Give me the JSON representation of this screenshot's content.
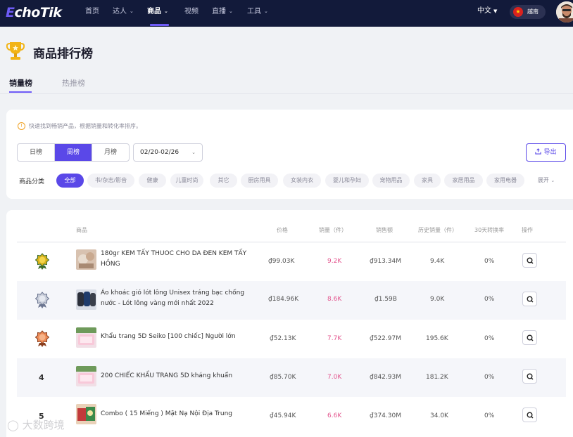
{
  "logo": {
    "first_letter": "E",
    "rest": "choTik"
  },
  "nav": {
    "items": [
      {
        "label": "首页",
        "chevron": false
      },
      {
        "label": "达人",
        "chevron": true
      },
      {
        "label": "商品",
        "chevron": true
      },
      {
        "label": "视频",
        "chevron": false
      },
      {
        "label": "直播",
        "chevron": true
      },
      {
        "label": "工具",
        "chevron": true
      }
    ],
    "active_index": 2,
    "language": "中文",
    "region": "越南"
  },
  "page": {
    "title": "商品排行榜",
    "tabs": [
      {
        "label": "销量榜"
      },
      {
        "label": "热推榜"
      }
    ]
  },
  "filters": {
    "hint": "快速找到畅销产品，根据销量和转化率排序。",
    "period_options": [
      "日榜",
      "周榜",
      "月榜"
    ],
    "period_selected": "周榜",
    "date_range": "02/20-02/26",
    "export_label": "导出",
    "category_label": "商品分类",
    "categories": [
      "全部",
      "书/杂志/影音",
      "健康",
      "儿童时尚",
      "其它",
      "厨房用具",
      "女装内衣",
      "婴儿和孕妇",
      "宠物用品",
      "家具",
      "家居用品",
      "家用电器"
    ],
    "category_selected": "全部",
    "expand_label": "展开"
  },
  "table": {
    "headers": {
      "product": "商品",
      "price": "价格",
      "sales": "销量（件）",
      "revenue": "销售额",
      "history_sales": "历史销量（件）",
      "conversion": "30天转换率",
      "action": "操作"
    },
    "rows": [
      {
        "rank": "1",
        "name": "180gr KEM TẤY THUOC CHO DA ĐEN KEM TẤY HỒNG",
        "price": "₫99.03K",
        "sales": "9.2K",
        "revenue": "₫913.34M",
        "history_sales": "9.4K",
        "conversion": "0%"
      },
      {
        "rank": "2",
        "name": "Áo khoác gió lót lông Unisex tráng bạc chống nước - Lót lông vàng mới nhất 2022",
        "price": "₫184.96K",
        "sales": "8.6K",
        "revenue": "₫1.59B",
        "history_sales": "9.0K",
        "conversion": "0%"
      },
      {
        "rank": "3",
        "name": "Khẩu trang 5D Seiko [100 chiếc] Người lớn",
        "price": "₫52.13K",
        "sales": "7.7K",
        "revenue": "₫522.97M",
        "history_sales": "195.6K",
        "conversion": "0%"
      },
      {
        "rank": "4",
        "name": "200 CHIẾC KHẨU TRANG 5D kháng khuẩn",
        "price": "₫85.70K",
        "sales": "7.0K",
        "revenue": "₫842.93M",
        "history_sales": "181.2K",
        "conversion": "0%"
      },
      {
        "rank": "5",
        "name": "Combo ( 15 Miếng ) Mặt Nạ Nội Địa Trung",
        "price": "₫45.94K",
        "sales": "6.6K",
        "revenue": "₫374.30M",
        "history_sales": "34.0K",
        "conversion": "0%"
      }
    ]
  },
  "watermark": "大数跨境",
  "colors": {
    "nav_bg": "#121a3a",
    "accent": "#5a48e8",
    "sales_pink": "#e3568e",
    "gold": "#d4a017",
    "silver": "#9aa3b8",
    "bronze": "#e07a4a"
  }
}
